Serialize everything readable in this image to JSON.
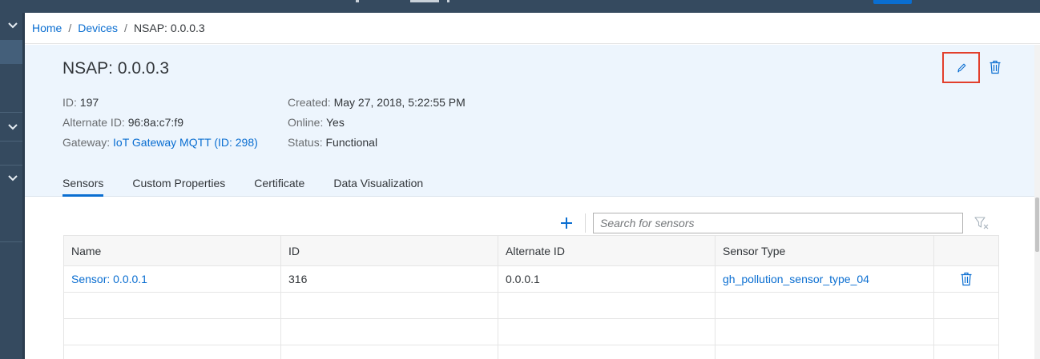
{
  "breadcrumb": {
    "home": "Home",
    "devices": "Devices",
    "sep": "/",
    "current": "NSAP: 0.0.0.3"
  },
  "device": {
    "title": "NSAP: 0.0.0.3",
    "id_label": "ID:",
    "id_value": "197",
    "alt_label": "Alternate ID:",
    "alt_value": "96:8a:c7:f9",
    "gateway_label": "Gateway:",
    "gateway_value": "IoT Gateway MQTT (ID: 298)",
    "created_label": "Created:",
    "created_value": "May 27, 2018, 5:22:55 PM",
    "online_label": "Online:",
    "online_value": "Yes",
    "status_label": "Status:",
    "status_value": "Functional"
  },
  "tabs": [
    "Sensors",
    "Custom Properties",
    "Certificate",
    "Data Visualization"
  ],
  "active_tab": "Sensors",
  "search": {
    "placeholder": "Search for sensors"
  },
  "table": {
    "headers": [
      "Name",
      "ID",
      "Alternate ID",
      "Sensor Type"
    ],
    "rows": [
      {
        "name": "Sensor: 0.0.0.1",
        "id": "316",
        "alternate_id": "0.0.0.1",
        "sensor_type": "gh_pollution_sensor_type_04"
      }
    ]
  },
  "icons": [
    "chevron-down-icon",
    "edit-icon",
    "trash-icon",
    "plus-icon",
    "filter-clear-icon"
  ],
  "colors": {
    "accent": "#0a6ed1",
    "shell": "#354a5f",
    "header_bg": "#edf5fd",
    "highlight": "#e23f2c"
  }
}
